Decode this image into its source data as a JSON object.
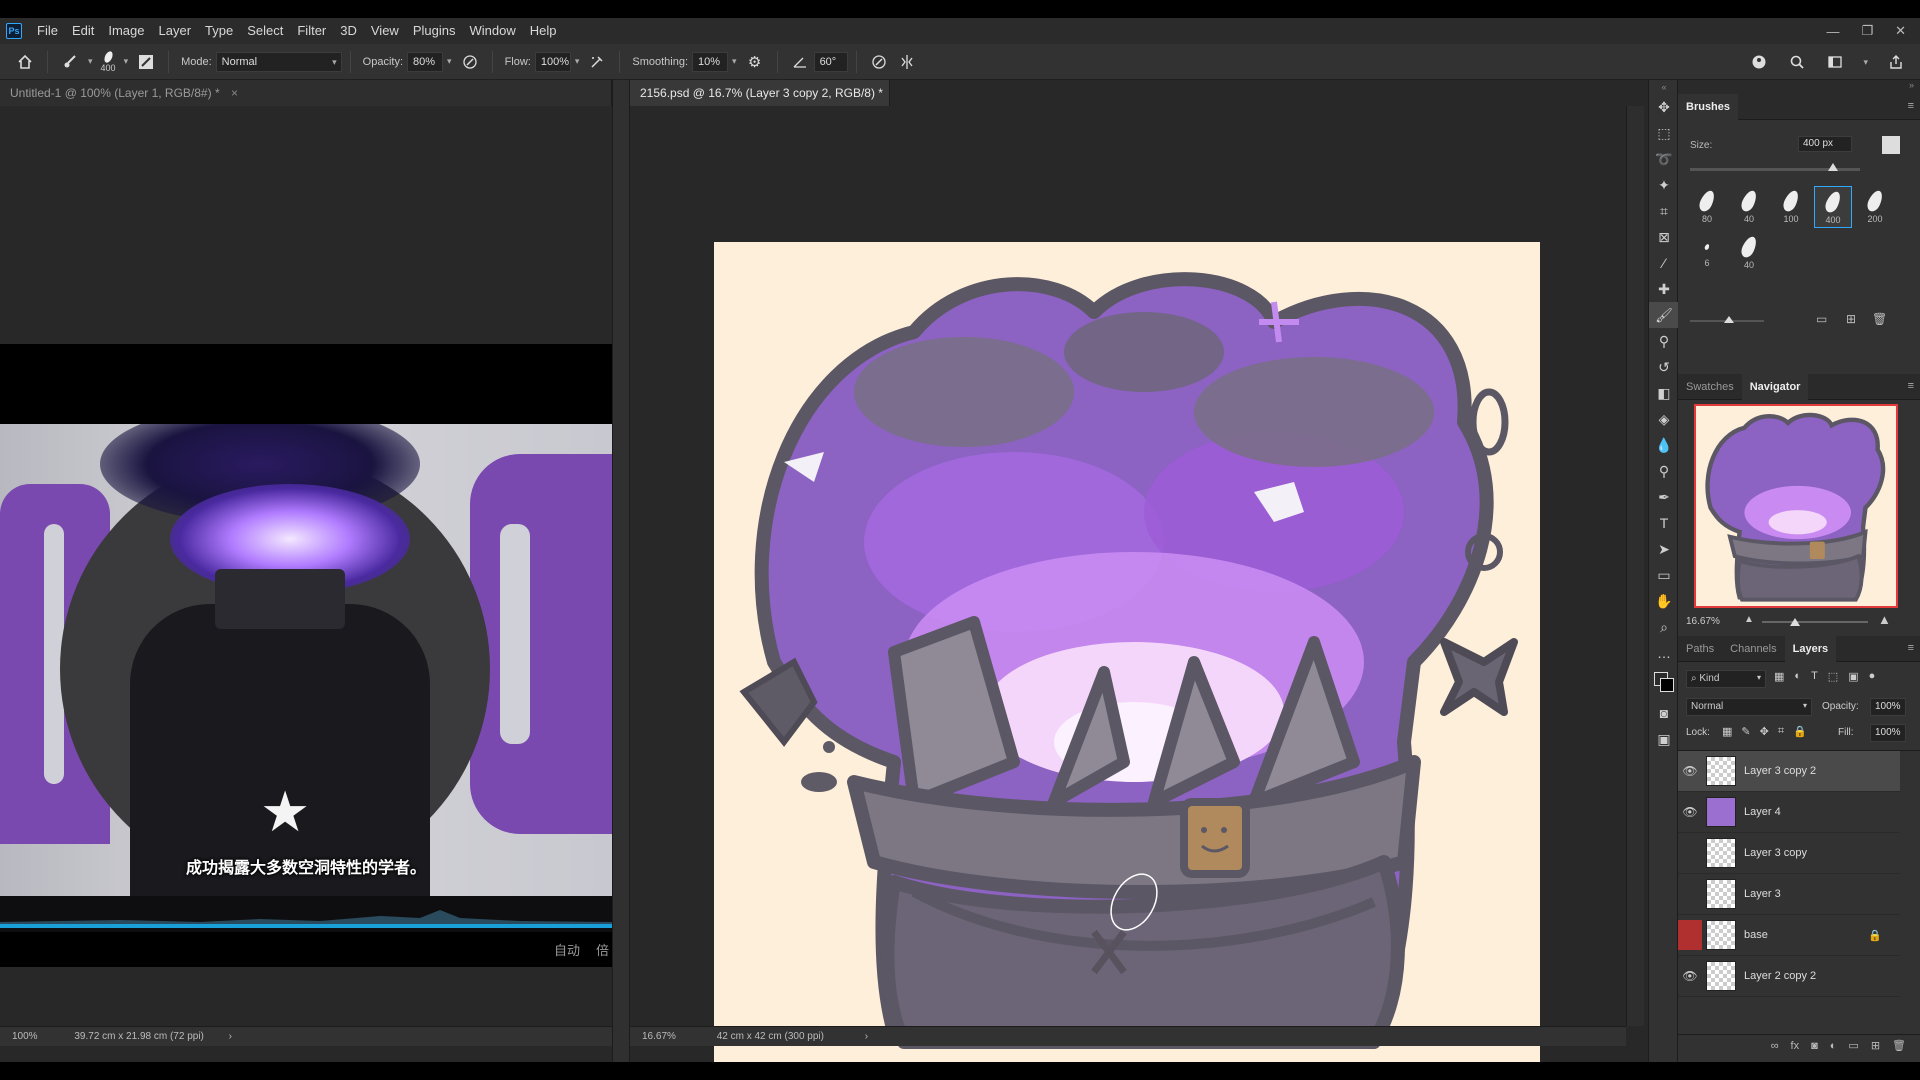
{
  "app": {
    "logo": "Ps"
  },
  "menu": [
    "File",
    "Edit",
    "Image",
    "Layer",
    "Type",
    "Select",
    "Filter",
    "3D",
    "View",
    "Plugins",
    "Window",
    "Help"
  ],
  "window_controls": {
    "minimize": "—",
    "restore": "❐",
    "close": "✕"
  },
  "options": {
    "brush_size": "400",
    "mode_label": "Mode:",
    "mode_value": "Normal",
    "opacity_label": "Opacity:",
    "opacity_value": "80%",
    "flow_label": "Flow:",
    "flow_value": "100%",
    "smoothing_label": "Smoothing:",
    "smoothing_value": "10%",
    "angle_value": "60°"
  },
  "tabs": [
    {
      "label": "Untitled-1 @ 100% (Layer 1, RGB/8#) *",
      "close": "×"
    },
    {
      "label": "2156.psd @ 16.7% (Layer 3 copy 2, RGB/8) *",
      "close": "×"
    }
  ],
  "status_left": {
    "zoom": "100%",
    "info": "39.72 cm x 21.98 cm (72 ppi)",
    "arrow": "›"
  },
  "status_right": {
    "zoom": "16.67%",
    "info": "42 cm x 42 cm (300 ppi)",
    "arrow": "›"
  },
  "video": {
    "subtitle": "成功揭露大多数空洞特性的学者。",
    "ctrl_auto": "自动",
    "ctrl_speed": "倍"
  },
  "brushes_panel": {
    "title": "Brushes",
    "size_label": "Size:",
    "size_value": "400 px",
    "presets": [
      "80",
      "40",
      "100",
      "400",
      "200",
      "6",
      "40"
    ]
  },
  "nav_panel": {
    "tabs": [
      "Swatches",
      "Navigator"
    ],
    "zoom": "16.67%"
  },
  "layers_panel": {
    "tabs": [
      "Paths",
      "Channels",
      "Layers"
    ],
    "kind_label": "Kind",
    "blend_mode": "Normal",
    "opacity_label": "Opacity:",
    "opacity_value": "100%",
    "lock_label": "Lock:",
    "fill_label": "Fill:",
    "fill_value": "100%",
    "layers": [
      {
        "name": "Layer 3 copy 2",
        "visible": true,
        "selected": true
      },
      {
        "name": "Layer 4",
        "visible": true,
        "selected": false
      },
      {
        "name": "Layer 3 copy",
        "visible": false,
        "selected": false
      },
      {
        "name": "Layer 3",
        "visible": false,
        "selected": false
      },
      {
        "name": "base",
        "visible": false,
        "selected": false,
        "locked": true
      },
      {
        "name": "Layer 2 copy 2",
        "visible": true,
        "selected": false
      }
    ]
  },
  "colors": {
    "accent": "#31a8ff",
    "canvas_bg": "#fdefd9",
    "purple": "#9a5bdc",
    "outline": "#5b5764"
  }
}
